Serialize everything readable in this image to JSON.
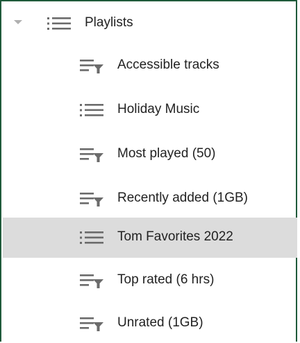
{
  "tree": {
    "root": {
      "label": "Playlists",
      "icon": "playlist-icon",
      "expanded": true
    },
    "items": [
      {
        "label": "Accessible tracks",
        "icon": "auto-playlist-icon",
        "selected": false
      },
      {
        "label": "Holiday Music",
        "icon": "playlist-icon",
        "selected": false
      },
      {
        "label": "Most played (50)",
        "icon": "auto-playlist-icon",
        "selected": false
      },
      {
        "label": "Recently added (1GB)",
        "icon": "auto-playlist-icon",
        "selected": false
      },
      {
        "label": "Tom Favorites 2022",
        "icon": "playlist-icon",
        "selected": true
      },
      {
        "label": "Top rated (6 hrs)",
        "icon": "auto-playlist-icon",
        "selected": false
      },
      {
        "label": "Unrated (1GB)",
        "icon": "auto-playlist-icon",
        "selected": false
      }
    ]
  },
  "colors": {
    "border": "#1f5a3a",
    "selected_bg": "#dcdcdc",
    "icon": "#6b6b6b",
    "text": "#222222"
  }
}
